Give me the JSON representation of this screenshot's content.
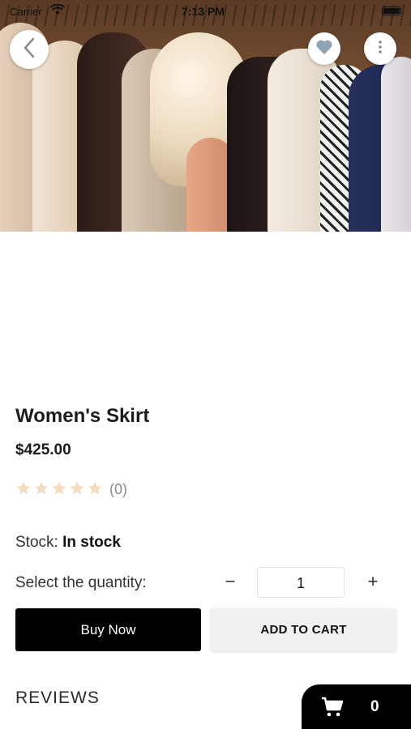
{
  "status_bar": {
    "carrier": "Carrier",
    "time": "7:13 PM"
  },
  "product": {
    "title": "Women's Skirt",
    "price": "$425.00",
    "rating": {
      "stars_filled": 0,
      "stars_total": 5,
      "count_label": "(0)"
    },
    "stock_label": "Stock:",
    "stock_value": "In stock",
    "quantity_label": "Select the quantity:",
    "quantity_value": "1",
    "minus_symbol": "−",
    "plus_symbol": "+"
  },
  "actions": {
    "buy_now": "Buy Now",
    "add_to_cart": "ADD TO CART"
  },
  "reviews_heading": "REVIEWS",
  "cart": {
    "count": "0"
  },
  "icons": {
    "back": "chevron-left-icon",
    "favorite": "heart-icon",
    "more": "more-vertical-icon",
    "cart": "shopping-cart-icon",
    "star": "star-icon"
  },
  "colors": {
    "primary": "#000000",
    "star_empty": "#f3dcc1",
    "secondary_button": "#f1f1f2",
    "heart": "#8fa3b0"
  }
}
